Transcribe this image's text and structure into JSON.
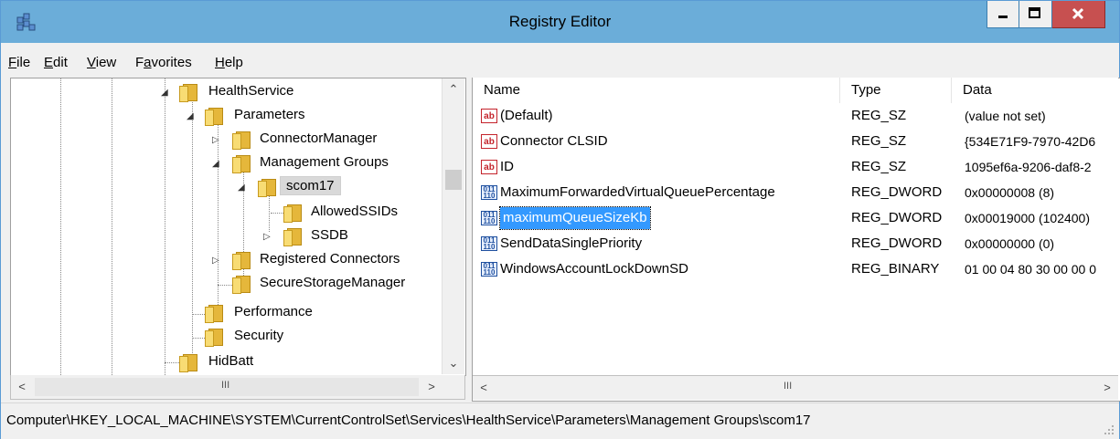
{
  "window": {
    "title": "Registry Editor"
  },
  "menu": [
    {
      "label": "File",
      "key": "F",
      "rest": "ile"
    },
    {
      "label": "Edit",
      "key": "E",
      "rest": "dit"
    },
    {
      "label": "View",
      "key": "V",
      "rest": "iew"
    },
    {
      "label": "Favorites",
      "key": "a",
      "pre": "F",
      "rest": "vorites"
    },
    {
      "label": "Help",
      "key": "H",
      "rest": "elp"
    }
  ],
  "tree": {
    "nodes": [
      {
        "label": "HealthService",
        "expanded": true
      },
      {
        "label": "Parameters",
        "expanded": true
      },
      {
        "label": "ConnectorManager",
        "expanded": false
      },
      {
        "label": "Management Groups",
        "expanded": true
      },
      {
        "label": "scom17",
        "expanded": true,
        "selected": true
      },
      {
        "label": "AllowedSSIDs"
      },
      {
        "label": "SSDB",
        "expanded": false
      },
      {
        "label": "Registered Connectors",
        "expanded": false
      },
      {
        "label": "SecureStorageManager"
      },
      {
        "label": "Performance"
      },
      {
        "label": "Security"
      },
      {
        "label": "HidBatt"
      }
    ]
  },
  "columns": {
    "name": "Name",
    "type": "Type",
    "data": "Data"
  },
  "values": [
    {
      "name": "(Default)",
      "type": "REG_SZ",
      "data": "(value not set)",
      "icon": "string-value-icon"
    },
    {
      "name": "Connector CLSID",
      "type": "REG_SZ",
      "data": "{534E71F9-7970-42D6",
      "icon": "string-value-icon"
    },
    {
      "name": "ID",
      "type": "REG_SZ",
      "data": "1095ef6a-9206-daf8-2",
      "icon": "string-value-icon"
    },
    {
      "name": "MaximumForwardedVirtualQueuePercentage",
      "type": "REG_DWORD",
      "data": "0x00000008 (8)",
      "icon": "binary-value-icon"
    },
    {
      "name": "maximumQueueSizeKb",
      "type": "REG_DWORD",
      "data": "0x00019000 (102400)",
      "icon": "binary-value-icon",
      "selected": true
    },
    {
      "name": "SendDataSinglePriority",
      "type": "REG_DWORD",
      "data": "0x00000000 (0)",
      "icon": "binary-value-icon"
    },
    {
      "name": "WindowsAccountLockDownSD",
      "type": "REG_BINARY",
      "data": "01 00 04 80 30 00 00 0",
      "icon": "binary-value-icon"
    }
  ],
  "icons": {
    "string_glyph": "ab",
    "binary_glyph": "011\n110",
    "scroll_track_glyph": "III"
  },
  "status": {
    "path": "Computer\\HKEY_LOCAL_MACHINE\\SYSTEM\\CurrentControlSet\\Services\\HealthService\\Parameters\\Management Groups\\scom17"
  },
  "colors": {
    "titlebar": "#6badd9",
    "selection": "#3399ff",
    "close": "#c75050"
  }
}
